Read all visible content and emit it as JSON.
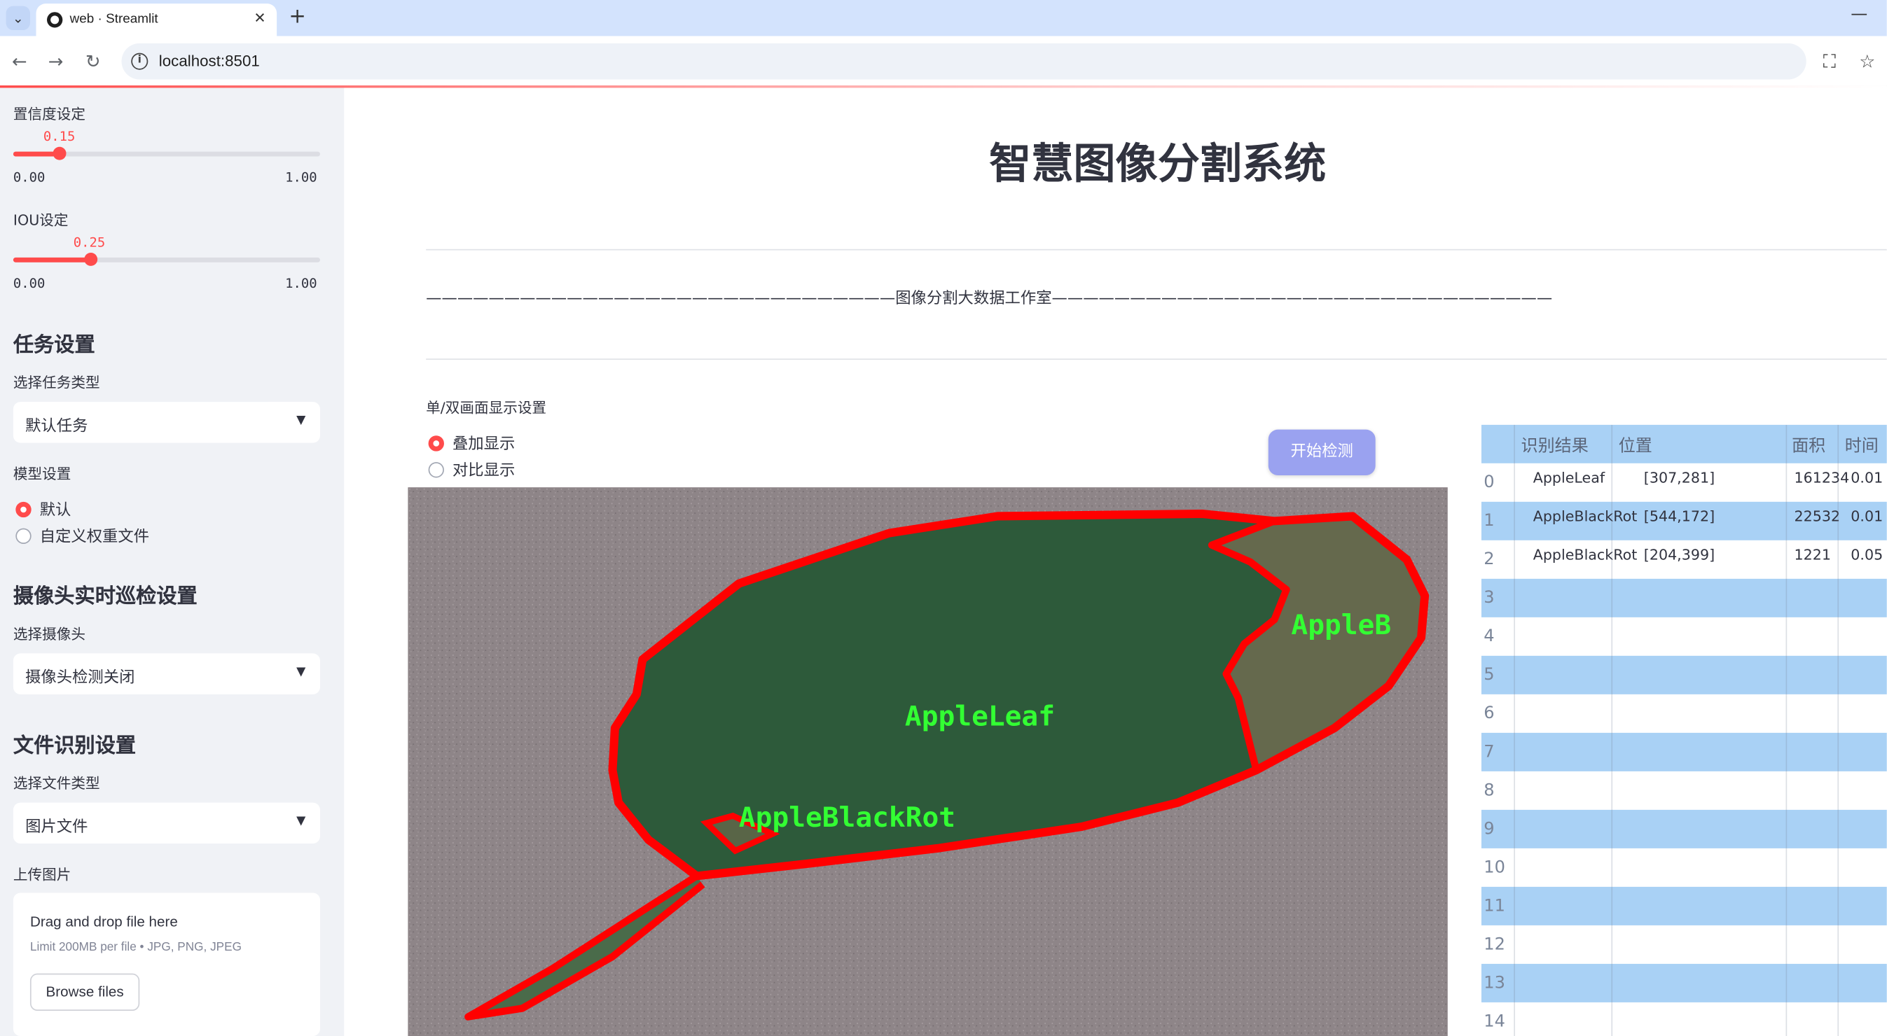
{
  "browser": {
    "tab_title": "web · Streamlit",
    "url": "localhost:8501"
  },
  "sidebar": {
    "confidence": {
      "label": "置信度设定",
      "value": "0.15",
      "level": 0.15,
      "min": "0.00",
      "max": "1.00"
    },
    "iou": {
      "label": "IOU设定",
      "value": "0.25",
      "level": 0.25,
      "min": "0.00",
      "max": "1.00"
    },
    "task_section": "任务设置",
    "task_type_label": "选择任务类型",
    "task_type_value": "默认任务",
    "model_label": "模型设置",
    "model_options": [
      "默认",
      "自定义权重文件"
    ],
    "camera_section": "摄像头实时巡检设置",
    "camera_label": "选择摄像头",
    "camera_value": "摄像头检测关闭",
    "file_section": "文件识别设置",
    "file_type_label": "选择文件类型",
    "file_type_value": "图片文件",
    "upload_label": "上传图片",
    "upload_title": "Drag and drop file here",
    "upload_limit": "Limit 200MB per file • JPG, PNG, JPEG",
    "browse_label": "Browse files"
  },
  "main": {
    "title": "智慧图像分割系统",
    "banner": "——————————————————————————————图像分割大数据工作室————————————————————————————————",
    "display_label": "单/双画面显示设置",
    "display_options": [
      "叠加显示",
      "对比显示"
    ],
    "start_button": "开始检测",
    "image_labels": [
      "AppleB",
      "AppleLeaf",
      "AppleBlackRot"
    ]
  },
  "table": {
    "columns": [
      "识别结果",
      "位置",
      "面积",
      "时间"
    ],
    "rows": [
      {
        "index": "0",
        "result": "AppleLeaf",
        "position": "[307,281]",
        "area": "161234",
        "time": "0.01"
      },
      {
        "index": "1",
        "result": "AppleBlackRot",
        "position": "[544,172]",
        "area": "22532",
        "time": "0.01"
      },
      {
        "index": "2",
        "result": "AppleBlackRot",
        "position": "[204,399]",
        "area": "1221",
        "time": "0.05"
      }
    ],
    "empty_indices": [
      "3",
      "4",
      "5",
      "6",
      "7",
      "8",
      "9",
      "10",
      "11",
      "12",
      "13",
      "14"
    ]
  },
  "colors": {
    "accent": "#ff4b4b",
    "button": "#9aa2f0",
    "table_header": "#a9d1f5",
    "sidebar_bg": "#f0f2f6",
    "leaf": "#2d5a3a",
    "mask_outline": "#ff0000",
    "label_green": "#33ff33"
  }
}
